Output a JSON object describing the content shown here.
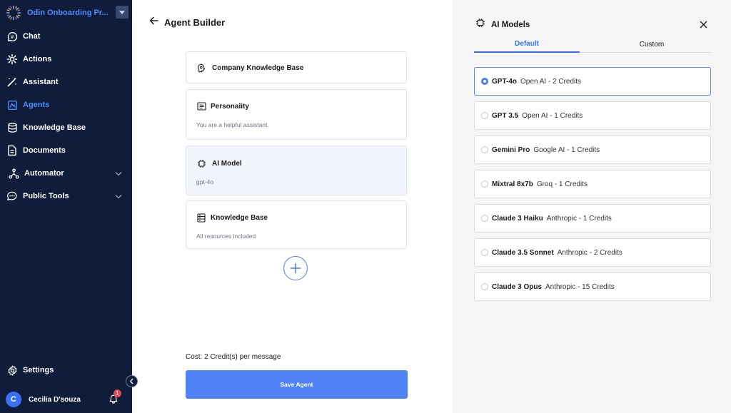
{
  "sidebar": {
    "workspace_name": "Odin Onboarding Pr...",
    "items": [
      {
        "label": "Chat"
      },
      {
        "label": "Actions"
      },
      {
        "label": "Assistant"
      },
      {
        "label": "Agents"
      },
      {
        "label": "Knowledge Base"
      },
      {
        "label": "Documents"
      },
      {
        "label": "Automator"
      },
      {
        "label": "Public Tools"
      }
    ],
    "active_item": "Agents",
    "settings_label": "Settings",
    "user": {
      "initial": "C",
      "name": "Cecilia D'souza",
      "notification_count": "1"
    }
  },
  "main": {
    "title": "Agent Builder",
    "cards": [
      {
        "title": "Company Knowledge Base",
        "subtitle": ""
      },
      {
        "title": "Personality",
        "subtitle": "You are a helpful assistant."
      },
      {
        "title": "AI Model",
        "subtitle": "gpt-4o"
      },
      {
        "title": "Knowledge Base",
        "subtitle": "All resources included"
      }
    ],
    "cost_text": "Cost: 2 Credit(s) per message",
    "save_label": "Save Agent"
  },
  "panel": {
    "title": "AI Models",
    "tabs": [
      {
        "label": "Default"
      },
      {
        "label": "Custom"
      }
    ],
    "active_tab": "Default",
    "models": [
      {
        "name": "GPT-4o",
        "meta": "Open AI - 2 Credits",
        "selected": true
      },
      {
        "name": "GPT 3.5",
        "meta": "Open AI - 1 Credits",
        "selected": false
      },
      {
        "name": "Gemini Pro",
        "meta": "Google AI - 1 Credits",
        "selected": false
      },
      {
        "name": "Mixtral 8x7b",
        "meta": "Groq - 1 Credits",
        "selected": false
      },
      {
        "name": "Claude 3 Haiku",
        "meta": "Anthropic - 1 Credits",
        "selected": false
      },
      {
        "name": "Claude 3.5 Sonnet",
        "meta": "Anthropic - 2 Credits",
        "selected": false
      },
      {
        "name": "Claude 3 Opus",
        "meta": "Anthropic - 15 Credits",
        "selected": false
      }
    ]
  },
  "icons": {
    "chat": "chat-bubble-icon",
    "actions": "gear-sparkle-icon",
    "assistant": "magic-wand-icon",
    "agents": "agent-icon",
    "knowledge_base": "database-icon",
    "documents": "document-icon",
    "automator": "flow-icon",
    "public_tools": "chat-dots-icon",
    "settings": "gear-icon",
    "chip": "chip-icon"
  },
  "colors": {
    "sidebar_bg": "#0f1c3a",
    "accent": "#4f8cff",
    "button": "#5083f5",
    "panel_bg": "#f5f5f5",
    "badge": "#e5484d"
  }
}
